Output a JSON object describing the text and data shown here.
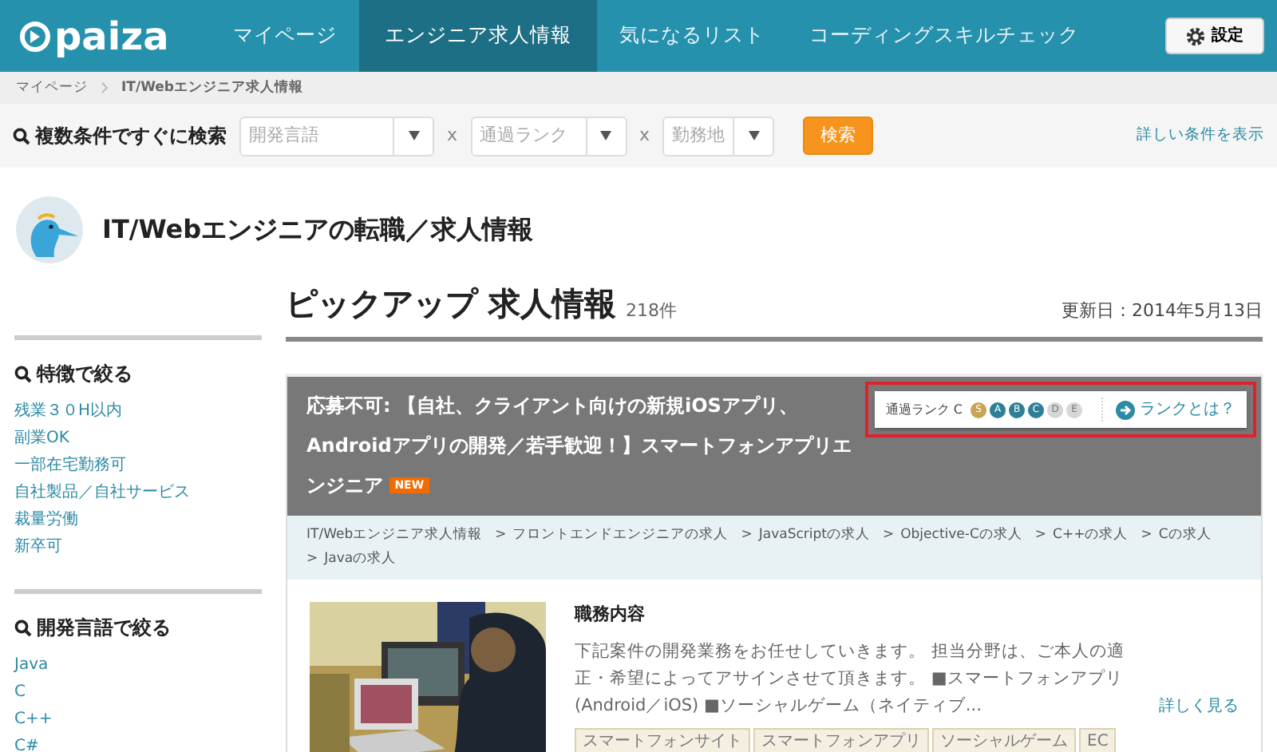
{
  "navbar": {
    "logo": "paiza",
    "items": [
      {
        "label": "マイページ",
        "selected": false
      },
      {
        "label": "エンジニア求人情報",
        "selected": true
      },
      {
        "label": "気になるリスト",
        "selected": false
      },
      {
        "label": "コーディングスキルチェック",
        "selected": false
      }
    ],
    "settings_button": "設定"
  },
  "breadcrumb": [
    "マイページ",
    "IT/Webエンジニア求人情報"
  ],
  "search": {
    "label": "複数条件ですぐに検索",
    "filters": [
      {
        "placeholder": "開発言語"
      },
      {
        "placeholder": "通過ランク"
      },
      {
        "placeholder": "勤務地"
      }
    ],
    "separators": [
      "x",
      "x"
    ],
    "button": "検索",
    "advanced_link": "詳しい条件を表示"
  },
  "page_title": "IT/Webエンジニアの転職／求人情報",
  "sidebar": {
    "sections": [
      {
        "title": "特徴で絞る",
        "items": [
          "残業３０H以内",
          "副業OK",
          "一部在宅勤務可",
          "自社製品／自社サービス",
          "裁量労働",
          "新卒可"
        ]
      },
      {
        "title": "開発言語で絞る",
        "items": [
          "Java",
          "C",
          "C++",
          "C#"
        ]
      }
    ]
  },
  "main": {
    "heading": "ピックアップ 求人情報",
    "count": "218件",
    "updated": "更新日：2014年5月13日",
    "job": {
      "title": "応募不可: 【自社、クライアント向けの新規iOSアプリ、Androidアプリの開発／若手歓迎！】スマートフォンアプリエンジニア",
      "badge": "NEW",
      "rank_label": "通過ランク C",
      "ranks": [
        {
          "label": "S",
          "color": "#c8a455"
        },
        {
          "label": "A",
          "color": "#2e7f96"
        },
        {
          "label": "B",
          "color": "#2e7f96"
        },
        {
          "label": "C",
          "color": "#2e7f96"
        },
        {
          "label": "D",
          "color": "#d6d6d6"
        },
        {
          "label": "E",
          "color": "#d6d6d6"
        }
      ],
      "rank_link": "ランクとは？",
      "categories": [
        "IT/Webエンジニア求人情報",
        "フロントエンドエンジニアの求人",
        "JavaScriptの求人",
        "Objective-Cの求人",
        "C++の求人",
        "Cの求人",
        "Javaの求人"
      ],
      "category_separator": ">",
      "section_title": "職務内容",
      "description": "下記案件の開発業務をお任せしていきます。 担当分野は、ご本人の適正・希望によってアサインさせて頂きます。 ■スマートフォンアプリ(Android／iOS) ■ソーシャルゲーム（ネイティブ...",
      "more_link": "詳しく見る",
      "tags": [
        "スマートフォンサイト",
        "スマートフォンアプリ",
        "ソーシャルゲーム",
        "EC"
      ]
    }
  }
}
